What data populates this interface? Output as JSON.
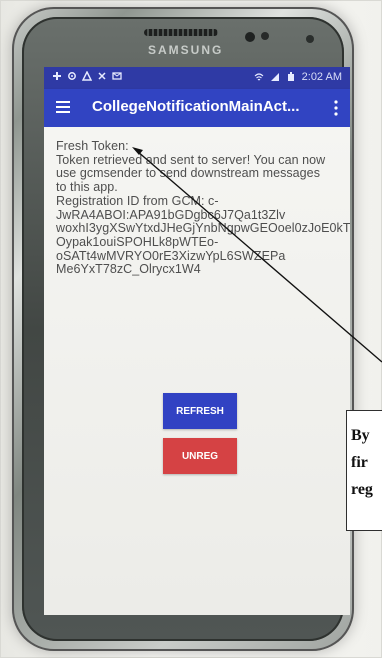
{
  "status_bar": {
    "time": "2:02 AM"
  },
  "app_bar": {
    "title": "CollegeNotificationMainAct..."
  },
  "content": {
    "message": "Fresh Token:\nToken retrieved and sent to server! You can now use gcmsender to send downstream messages to this app.\nRegistration ID from GCM: c-JwRA4ABOI:APA91bGDgbc6J7Qa1t3Zlv woxhI3ygXSwYtxdJHeGjYnbNgpwGEOoel0zJoE0kT7FfH-Oypak1ouiSPOHLk8pWTEo-oSATt4wMVRYO0rE3XizwYpL6SWZEPa Me6YxT78zC_Olrycx1W4",
    "refresh_label": "REFRESH",
    "unreg_label": "UNREG"
  },
  "device": {
    "brand": "SAMSUNG"
  },
  "callout": {
    "text": "By\nfir\nreg"
  },
  "colors": {
    "status_bar": "#2f3aa5",
    "app_bar": "#3144c2",
    "refresh_button": "#3142c3",
    "unreg_button": "#d54244",
    "screen_background": "#f4f4f1"
  },
  "icons": [
    "menu-icon",
    "overflow-menu-icon",
    "notification-icons",
    "wifi-icon",
    "signal-icon",
    "battery-icon"
  ]
}
